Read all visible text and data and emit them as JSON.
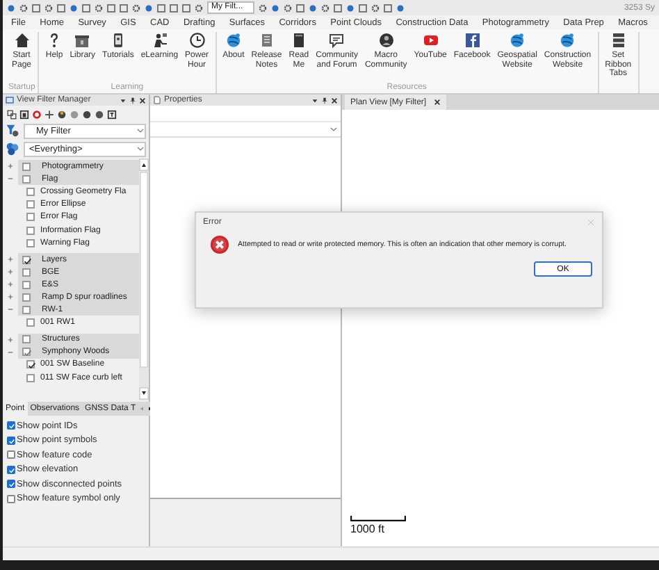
{
  "quick_access": {
    "filter_field": "My Filt...",
    "window_title": "3253 Sy"
  },
  "ribbon_tabs": [
    "File",
    "Home",
    "Survey",
    "GIS",
    "CAD",
    "Drafting",
    "Surfaces",
    "Corridors",
    "Point Clouds",
    "Construction Data",
    "Photogrammetry",
    "Data Prep",
    "Macros"
  ],
  "ribbon_groups": [
    {
      "label": "Startup",
      "buttons": [
        {
          "label": "Start Page"
        }
      ]
    },
    {
      "label": "Learning",
      "buttons": [
        {
          "label": "Help"
        },
        {
          "label": "Library"
        },
        {
          "label": "Tutorials"
        },
        {
          "label": "eLearning"
        },
        {
          "label": "Power Hour"
        }
      ]
    },
    {
      "label": "Resources",
      "buttons": [
        {
          "label": "About"
        },
        {
          "label": "Release Notes"
        },
        {
          "label": "Read Me"
        },
        {
          "label": "Community and Forum"
        },
        {
          "label": "Macro Community"
        },
        {
          "label": "YouTube"
        },
        {
          "label": "Facebook"
        },
        {
          "label": "Geospatial Website"
        },
        {
          "label": "Construction Website"
        }
      ]
    },
    {
      "buttons": [
        {
          "label": "Set Ribbon Tabs"
        }
      ]
    }
  ],
  "filter_panel": {
    "title": "View Filter Manager",
    "filter": "My Filter",
    "scope": "<Everything>",
    "tree": [
      {
        "label": "Photogrammetry",
        "expanded": false,
        "checked": false
      },
      {
        "label": "Flag",
        "expanded": true,
        "checked": false,
        "children": [
          {
            "label": "Crossing Geometry Fla",
            "checked": false
          },
          {
            "label": "Error Ellipse",
            "checked": false
          },
          {
            "label": "Error Flag",
            "checked": false
          },
          {
            "label": "Information Flag",
            "checked": false
          },
          {
            "label": "Warning Flag",
            "checked": false
          }
        ]
      },
      {
        "label": "Layers",
        "expanded": false,
        "checked": true
      },
      {
        "label": "BGE",
        "expanded": false,
        "checked": false
      },
      {
        "label": "E&S",
        "expanded": false,
        "checked": false
      },
      {
        "label": "Ramp D spur roadlines",
        "expanded": false,
        "checked": false
      },
      {
        "label": "RW-1",
        "expanded": true,
        "checked": false,
        "children": [
          {
            "label": "001 RW1",
            "checked": false
          }
        ]
      },
      {
        "label": "Structures",
        "expanded": false,
        "checked": false
      },
      {
        "label": "Symphony Woods",
        "expanded": true,
        "checked": true,
        "children": [
          {
            "label": "001 SW Baseline",
            "checked": true
          },
          {
            "label": "011 SW Face curb left",
            "checked": false
          }
        ]
      }
    ],
    "tabs": [
      {
        "label": "Point",
        "selected": true
      },
      {
        "label": "Observations",
        "selected": false
      },
      {
        "label": "GNSS Data T",
        "selected": false
      }
    ],
    "options": [
      {
        "label": "Show point IDs",
        "checked": true
      },
      {
        "label": "Show point symbols",
        "checked": true
      },
      {
        "label": "Show feature code",
        "checked": false
      },
      {
        "label": "Show elevation",
        "checked": true
      },
      {
        "label": "Show disconnected points",
        "checked": true
      },
      {
        "label": "Show feature symbol only",
        "checked": false
      }
    ]
  },
  "properties_panel": {
    "title": "Properties"
  },
  "plan_view": {
    "tab": "Plan View [My Filter]",
    "scale_label": "1000 ft"
  },
  "dialog": {
    "title": "Error",
    "message": "Attempted to read or write protected memory. This is often an indication that other memory is corrupt.",
    "button": "OK"
  }
}
